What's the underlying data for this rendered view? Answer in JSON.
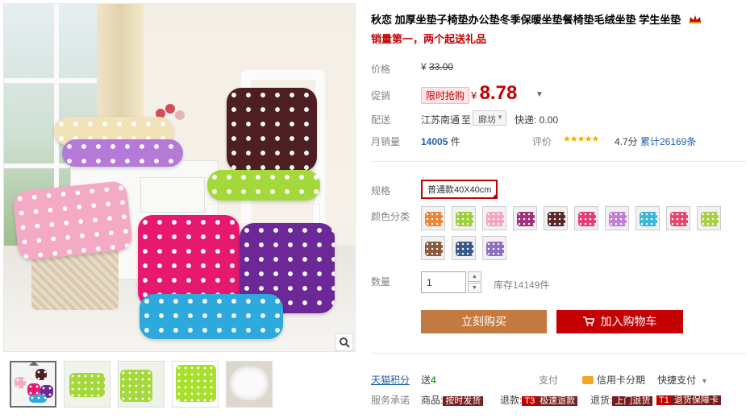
{
  "product": {
    "title": "秋恋 加厚坐垫子椅垫办公垫冬季保暖坐垫餐椅垫毛绒坐垫 学生坐垫",
    "subtitle": "销量第一，两个起送礼品"
  },
  "price": {
    "label": "价格",
    "original_currency": "¥",
    "original": "33.00",
    "promo_label": "促销",
    "flash_badge": "限时抢购",
    "current_currency": "¥",
    "current": "8.78"
  },
  "delivery": {
    "label": "配送",
    "from": "江苏南通",
    "to_word": "至",
    "city": "廊坊",
    "express": "快递: 0.00"
  },
  "sales": {
    "label": "月销量",
    "count": "14005",
    "unit": "件",
    "rating_label": "评价",
    "stars": "★★★★★",
    "score": "4.7分",
    "reviews": "累计26169条"
  },
  "spec": {
    "label": "规格",
    "selected": "普通款40X40cm"
  },
  "colors": {
    "label": "颜色分类",
    "swatches": [
      "#e8873c",
      "#9ccf3a",
      "#f2a6c4",
      "#a0317a",
      "#5a2a2a",
      "#e83c79",
      "#c37fd6",
      "#3fb6d8",
      "#e04a6e",
      "#a8cf46",
      "#8b5a3c",
      "#3a5a8c",
      "#8e6fbf"
    ]
  },
  "quantity": {
    "label": "数量",
    "value": "1",
    "stock": "库存14149件"
  },
  "buttons": {
    "buy": "立刻购买",
    "cart": "加入购物车"
  },
  "points": {
    "label": "天猫积分",
    "value_prefix": "送",
    "value": "4"
  },
  "payment": {
    "label": "支付",
    "credit": "信用卡分期",
    "quick": "快捷支付"
  },
  "service": {
    "label": "服务承诺",
    "goods": "商品:",
    "goods_tag": "按时发货",
    "refund": "退款:",
    "refund_tag_prefix": "T3",
    "refund_tag": "极速退款",
    "return": "退货:",
    "return_tag": "上门退货",
    "guarantee_prefix": "T1",
    "guarantee_tag": "退货保障卡"
  },
  "colors_theme": {
    "accent_red": "#c40000",
    "buy_orange": "#c47a3f",
    "link_blue": "#1f61ac"
  }
}
